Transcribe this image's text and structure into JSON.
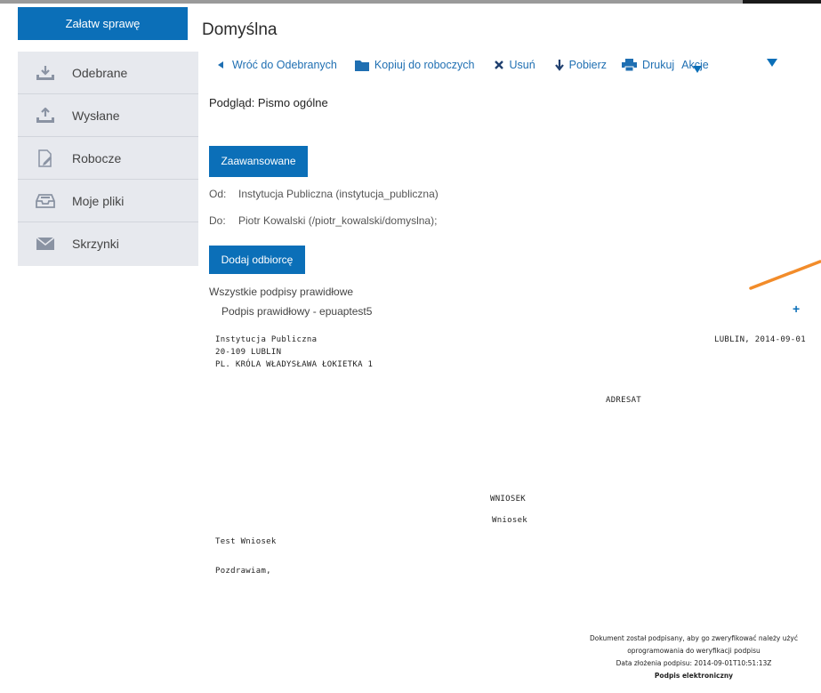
{
  "sidebar": {
    "action_button": "Załatw sprawę",
    "items": [
      {
        "label": "Odebrane",
        "icon": "download-tray-icon"
      },
      {
        "label": "Wysłane",
        "icon": "upload-tray-icon"
      },
      {
        "label": "Robocze",
        "icon": "document-pencil-icon"
      },
      {
        "label": "Moje pliki",
        "icon": "inbox-tray-icon"
      },
      {
        "label": "Skrzynki",
        "icon": "envelope-icon"
      }
    ]
  },
  "main": {
    "title": "Domyślna",
    "toolbar": [
      {
        "label": "Wróć do Odebranych",
        "icon": "back-arrow-icon"
      },
      {
        "label": "Kopiuj do roboczych",
        "icon": "folder-icon"
      },
      {
        "label": "Usuń",
        "icon": "close-x-icon"
      },
      {
        "label": "Pobierz",
        "icon": "download-arrow-icon"
      },
      {
        "label": "Drukuj",
        "icon": "printer-icon"
      },
      {
        "label": "Akcje",
        "icon": "more-arrow-icon"
      }
    ],
    "preview_title": "Podgląd: Pismo ogólne",
    "advanced_button": "Zaawansowane",
    "from_key": "Od:",
    "from_value": "Instytucja Publiczna (instytucja_publiczna)",
    "to_key": "Do:",
    "to_value": "Piotr Kowalski (/piotr_kowalski/domyslna);",
    "add_recipient_button": "Dodaj odbiorcę",
    "signatures_status": "Wszystkie podpisy prawidłowe",
    "signature_item": "Podpis prawidłowy - epuaptest5",
    "plus": "+"
  },
  "document": {
    "sender_name": "Instytucja Publiczna",
    "sender_city": "20-109 LUBLIN",
    "sender_street": "PL. KRÓLA WŁADYSŁAWA ŁOKIETKA 1",
    "place_date": "LUBLIN, 2014-09-01",
    "recipient_label": "ADRESAT",
    "heading": "WNIOSEK",
    "subheading": "Wniosek",
    "body": "Test Wniosek",
    "closing": "Pozdrawiam,",
    "footer_line1": "Dokument został podpisany, aby go zweryfikować należy użyć",
    "footer_line2": "oprogramowania do weryfikacji podpisu",
    "footer_line3": "Data złożenia podpisu: 2014-09-01T10:51:13Z",
    "footer_line4": "Podpis elektroniczny"
  },
  "colors": {
    "accent": "#0b6fb8",
    "sidebar_bg": "#e7e9ee",
    "orange_annotation": "#f28c2a"
  }
}
